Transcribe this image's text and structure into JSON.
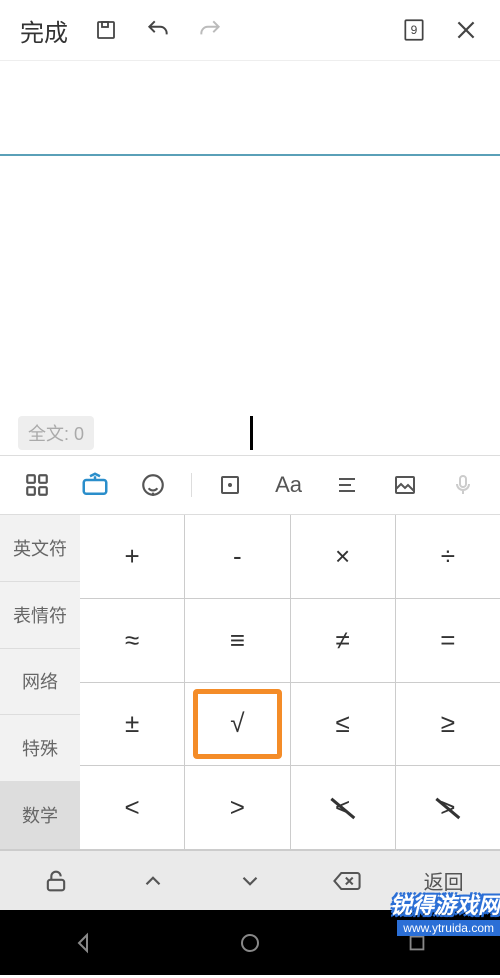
{
  "topbar": {
    "done": "完成",
    "page_badge": "9"
  },
  "editor": {
    "word_count_label": "全文: 0"
  },
  "categories": [
    "英文符",
    "表情符",
    "网络",
    "特殊",
    "数学"
  ],
  "active_category_index": 4,
  "symbol_grid": [
    [
      "+",
      "-",
      "×",
      "÷"
    ],
    [
      "≈",
      "≡",
      "≠",
      "="
    ],
    [
      "±",
      "√",
      "≤",
      "≥"
    ],
    [
      "<",
      ">",
      "≮",
      "≯"
    ]
  ],
  "highlighted_cell": [
    2,
    1
  ],
  "bottombar": {
    "return_label": "返回"
  },
  "watermark": {
    "title": "锐得游戏网",
    "url": "www.ytruida.com"
  }
}
